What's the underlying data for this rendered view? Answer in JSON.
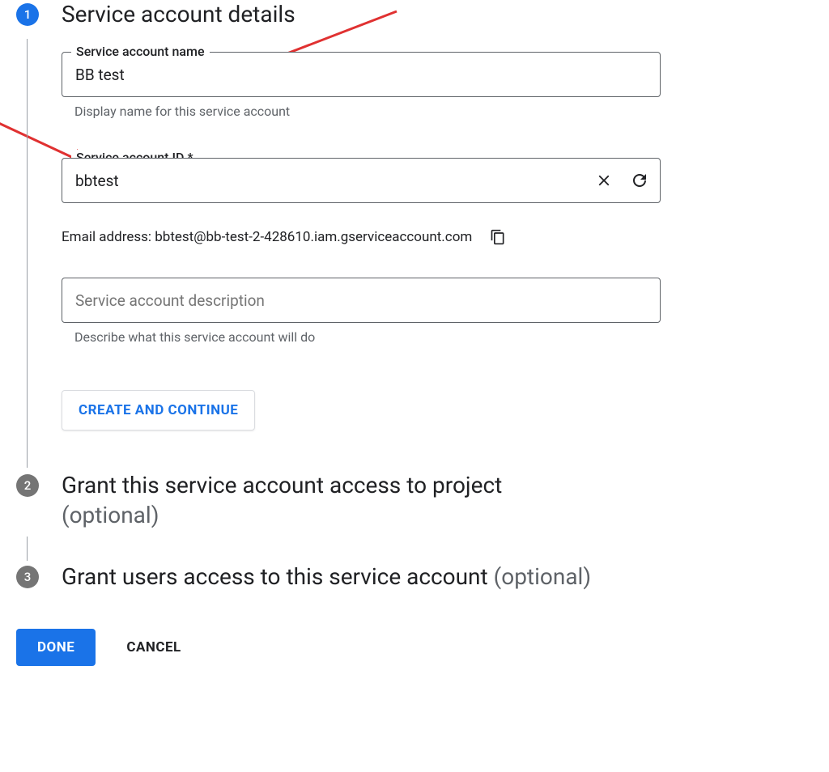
{
  "step1": {
    "number": "1",
    "title": "Service account details",
    "name_field": {
      "label": "Service account name",
      "value": "BB test",
      "helper": "Display name for this service account"
    },
    "id_field": {
      "label": "Service account ID *",
      "value": "bbtest"
    },
    "email_label": "Email address: bbtest@bb-test-2-428610.iam.gserviceaccount.com",
    "desc_field": {
      "placeholder": "Service account description",
      "helper": "Describe what this service account will do"
    },
    "create_button": "CREATE AND CONTINUE"
  },
  "step2": {
    "number": "2",
    "title": "Grant this service account access to project",
    "optional": "(optional)"
  },
  "step3": {
    "number": "3",
    "title": "Grant users access to this service account ",
    "optional": "(optional)"
  },
  "buttons": {
    "done": "DONE",
    "cancel": "CANCEL"
  }
}
